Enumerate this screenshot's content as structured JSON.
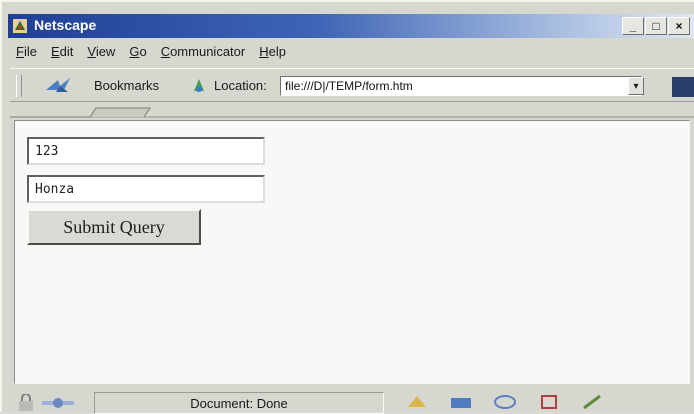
{
  "window": {
    "title": "Netscape",
    "controls": [
      "_",
      "□",
      "×"
    ]
  },
  "menu": [
    {
      "label": "File",
      "mnemonic": "F",
      "rest": "ile"
    },
    {
      "label": "Edit",
      "mnemonic": "E",
      "rest": "dit"
    },
    {
      "label": "View",
      "mnemonic": "V",
      "rest": "iew"
    },
    {
      "label": "Go",
      "mnemonic": "G",
      "rest": "o"
    },
    {
      "label": "Communicator",
      "mnemonic": "C",
      "rest": "ommunicator"
    },
    {
      "label": "Help",
      "mnemonic": "H",
      "rest": "elp"
    }
  ],
  "location_bar": {
    "bookmarks_label": "Bookmarks",
    "location_label": "Location:",
    "url": "file:///D|/TEMP/form.htm"
  },
  "form": {
    "field1_value": "123",
    "field2_value": "Honza",
    "submit_label": "Submit Query"
  },
  "status": {
    "text": "Document: Done"
  },
  "colors": {
    "title_bar_start": "#1f3f94",
    "title_bar_end": "#dfe7f2",
    "chrome": "#d6d8d0",
    "content_bg": "#f8f9f7"
  }
}
